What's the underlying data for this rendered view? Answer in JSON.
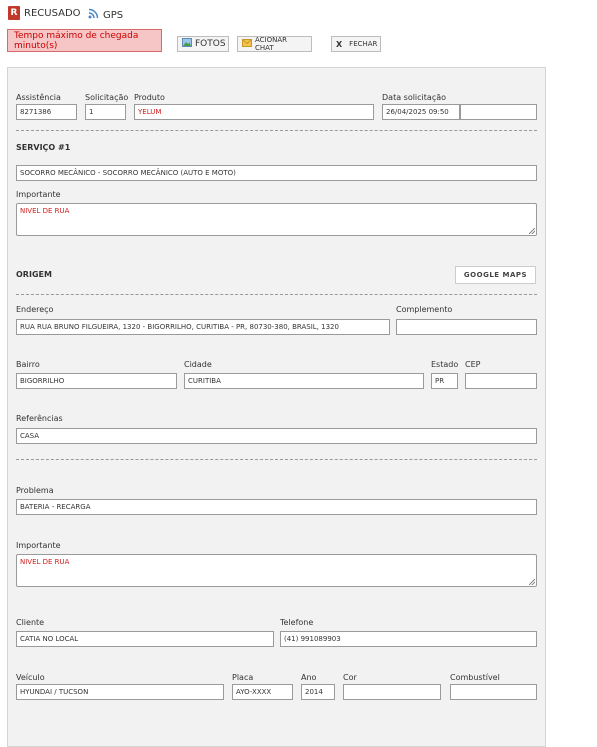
{
  "header": {
    "status_badge": "R",
    "status_label": "RECUSADO",
    "gps_label": "GPS",
    "alert_text": "Tempo máximo de chegada minuto(s)",
    "fotos_label": "FOTOS",
    "chat_label": "ACIONAR CHAT",
    "close_x": "X",
    "close_label": "FECHAR"
  },
  "top_fields": {
    "assistencia_label": "Assistência",
    "assistencia_value": "8271386",
    "solicitacao_label": "Solicitação",
    "solicitacao_value": "1",
    "produto_label": "Produto",
    "produto_value": "YELUM",
    "data_label": "Data solicitação",
    "data_value": "26/04/2025 09:50",
    "data_extra_value": ""
  },
  "servico": {
    "title": "SERVIÇO #1",
    "value": "SOCORRO MECÂNICO - SOCORRO MECÂNICO (AUTO E MOTO)",
    "importante_label": "Importante",
    "importante_value": "NIVEL DE RUA"
  },
  "origem": {
    "title": "ORIGEM",
    "maps_button": "GOOGLE MAPS",
    "endereco_label": "Endereço",
    "endereco_value": "RUA RUA BRUNO FILGUEIRA, 1320 - BIGORRILHO, CURITIBA - PR, 80730-380, BRASIL, 1320",
    "complemento_label": "Complemento",
    "complemento_value": "",
    "bairro_label": "Bairro",
    "bairro_value": "BIGORRILHO",
    "cidade_label": "Cidade",
    "cidade_value": "CURITIBA",
    "estado_label": "Estado",
    "estado_value": "PR",
    "cep_label": "CEP",
    "cep_value": "",
    "referencias_label": "Referências",
    "referencias_value": "CASA"
  },
  "detalhes": {
    "problema_label": "Problema",
    "problema_value": "BATERIA - RECARGA",
    "importante_label": "Importante",
    "importante_value": "NIVEL DE RUA",
    "cliente_label": "Cliente",
    "cliente_value": "CATIA NO LOCAL",
    "telefone_label": "Telefone",
    "telefone_value": "(41) 991089903",
    "veiculo_label": "Veículo",
    "veiculo_value": "HYUNDAI / TUCSON",
    "placa_label": "Placa",
    "placa_value": "AYO-XXXX",
    "ano_label": "Ano",
    "ano_value": "2014",
    "cor_label": "Cor",
    "cor_value": "",
    "combustivel_label": "Combustível",
    "combustivel_value": ""
  },
  "colors": {
    "accent_red": "#d21a1a",
    "alert_bg": "#f6c6c6",
    "badge_red": "#c0392b",
    "panel_bg": "#f2f2f2"
  }
}
